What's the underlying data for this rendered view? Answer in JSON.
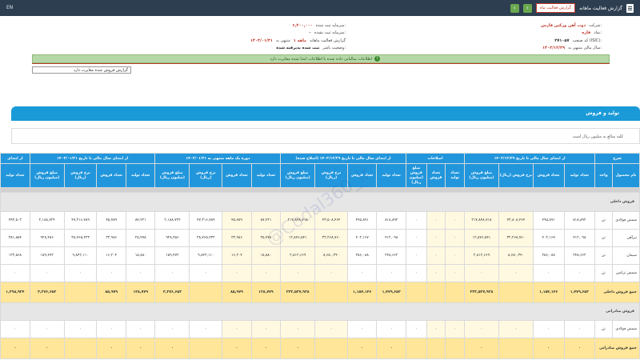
{
  "topbar": {
    "left_label": "EN",
    "title": "گزارش فعالیت ماهانه",
    "red_button": "گزارش فعالیت ماه"
  },
  "info": {
    "company_label": "شرکت:",
    "company_value": "ذوب آهن ورکین فارس",
    "symbol_label": "نماد:",
    "symbol_value": "فاره",
    "isic_label": "کد صنعت (ISIC):",
    "isic_value": "۲۷۱۰۵۷",
    "fiscal_label": "سال مالی منتهی به:",
    "fiscal_value": "۱۴۰۲/۱۲/۲۹",
    "capital_label": "سرمایه ثبت شده:",
    "capital_value": "۶,۲۰۰,۰۰۰",
    "unregistered_label": "سرمایه ثبت نشده:",
    "unregistered_value": "۰",
    "report_label": "گزارش فعالیت ماهانه",
    "month_label": "۱ ماهه",
    "period_label": "منتهی به",
    "period_value": "۱۴۰۳/۰۱/۳۱",
    "status_label": "وضعیت ناشر:",
    "status_value": "ثبت شده پذیرفته شده",
    "green_notice": "اطلاعات سالیانی داده شده با اطلاعات ابتدا شده مغایرت دارد",
    "dropdown_value": "گزارش فروش شده مغایرت دارد"
  },
  "section": {
    "title": "تولید و فروش",
    "note": "کلیه مبالغ به میلیون ریال است"
  },
  "table": {
    "groups": [
      "شرح",
      "از ابتدای سال مالی تا تاریخ ۱۴۰۲/۱۲/۲۹",
      "اصلاحات",
      "از ابتدای سال مالی تا تاریخ ۱۴۰۲/۱۲/۲۹ (اصلاح شده)",
      "دوره یک ماهه منتهی به ۱۴۰۳/۰۱/۳۱",
      "از ابتدای سال مالی تا تاریخ ۱۴۰۳/۰۱/۳۱",
      "از ابتدای"
    ],
    "columns": [
      "نام محصول",
      "واحد",
      "تعداد تولید",
      "تعداد فروش",
      "نرخ فروش (ریال)",
      "مبلغ فروش (میلیون ریال)",
      "تعداد تولید",
      "تعداد فروش",
      "مبلغ فروش (میلیون ریال)",
      "تعداد تولید",
      "تعداد فروش",
      "نرخ فروش (ریال)",
      "مبلغ فروش (میلیون ریال)",
      "تعداد تولید",
      "تعداد فروش",
      "نرخ فروش (ریال)",
      "مبلغ فروش (میلیون ریال)",
      "تعداد تولید",
      "تعداد فروش",
      "نرخ فروش (ریال)",
      "مبلغ فروش (میلیون ریال)",
      "تعداد تولید"
    ],
    "group1_label": "فروش داخلی",
    "rows": [
      {
        "name": "شمش فولادی",
        "unit": "تن",
        "c": [
          "۸۱۸,۸۹۲",
          "۴۹۵,۸۹۱",
          "۴۳,۸۰۸,۴۶۴",
          "۲۱۷,۸۴۸,۷۱۸",
          "۰",
          "۰",
          "۰",
          "۸۱۸,۸۹۲",
          "۴۹۵,۸۹۱",
          "۴۳,۵۰۸,۴۶۴",
          "۲۱۷,۸۴۸,۷۱۸",
          "۸۷,۴۲۱",
          "۴۵,۷۸۹",
          "۴۷,۳۱۶,۷۸۹",
          "۲,۱۸۸,۷۲۴",
          "۸۷,۴۲۱",
          "۴۵,۷۸۹",
          "۴۷,۳۱۶,۷۸۹",
          "۲,۱۸۸,۷۲۴",
          "۷۹۳,۵۰۲"
        ]
      },
      {
        "name": "تیرآهن",
        "unit": "تن",
        "c": [
          "۴۱۲,۰۹۸",
          "۴۰۲,۱۶۷",
          "۳۲,۲۶۸,۷۶۰",
          "۱۲,۸۷۶,۵۴۱",
          "۰",
          "۰",
          "۰",
          "۴۱۲,۰۹۸",
          "۴۰۲,۱۶۷",
          "۳۲,۲۶۸,۷۶۰",
          "۱۲,۸۷۶,۵۴۱",
          "۲۵,۴۷۸",
          "۲۳,۹۸۶",
          "۳۸,۷۶۵,۴۳۲",
          "۹۲۸,۴۵۶",
          "۲۵,۴۷۸",
          "۲۳,۹۸۶",
          "۳۸,۷۶۵,۴۳۲",
          "۹۲۸,۴۵۶",
          "۳۸۱,۸۵۴"
        ]
      },
      {
        "name": "سیمان",
        "unit": "تن",
        "c": [
          "۲۴۸,۶۶۲",
          "۲۵۶,۰۸۸",
          "۸,۶۵۰,۳۴۰",
          "۲,۸۱۲,۶۶۹",
          "۰",
          "۰",
          "۰",
          "۲۴۸,۶۶۲",
          "۲۵۶,۰۸۸",
          "۸,۶۵۰,۳۴۰",
          "۲,۸۱۲,۶۶۹",
          "۱۵,۸۸۰",
          "۱۶,۲۰۴",
          "۹,۸۴۲,۱۱۰",
          "۱۵۹,۴۷۲",
          "۱۵,۸۸۰",
          "۱۶,۲۰۴",
          "۹,۸۴۲,۱۱۰",
          "۱۵۹,۴۷۲",
          "۱۲۳,۵۶۸"
        ]
      },
      {
        "name": "شمش ترانس",
        "unit": "تن",
        "c": [
          "۰",
          "۰",
          "۰",
          "۰",
          "۰",
          "۰",
          "۰",
          "۰",
          "۰",
          "۰",
          "۰",
          "۰",
          "۰",
          "۰",
          "۰",
          "۰",
          "۰",
          "۰",
          "۰",
          "۰"
        ]
      }
    ],
    "sum1": {
      "label": "جمع فروش داخلی",
      "c": [
        "۱,۴۷۹,۶۵۲",
        "۱,۱۵۴,۱۴۶",
        "",
        "۲۳۳,۵۳۷,۹۲۸",
        "",
        "",
        "",
        "۱,۴۷۹,۶۵۲",
        "۱,۱۵۴,۱۴۶",
        "",
        "۲۳۳,۵۳۷,۹۲۸",
        "۱۲۸,۷۷۹",
        "۸۵,۹۷۹",
        "",
        "۳,۲۷۶,۶۵۲",
        "۱۲۸,۷۷۹",
        "۸۵,۹۷۹",
        "",
        "۳,۲۷۶,۶۵۲",
        "۱,۲۹۸,۹۲۴"
      ]
    },
    "group2_label": "فروش صادراتی",
    "row2": {
      "name": "شمش فولادی",
      "unit": "تن",
      "c": [
        "۰",
        "۰",
        "۰",
        "۰",
        "۰",
        "۰",
        "۰",
        "۰",
        "۰",
        "۰",
        "۰",
        "۰",
        "۰",
        "۰",
        "۰",
        "۰",
        "۰",
        "۰",
        "۰",
        "۰"
      ]
    },
    "sum2": {
      "label": "جمع فروش صادراتی",
      "c": [
        "۰",
        "۰",
        "",
        "۰",
        "",
        "",
        "",
        "۰",
        "۰",
        "",
        "۰",
        "۰",
        "۰",
        "",
        "۰",
        "۰",
        "۰",
        "",
        "۰",
        "۰"
      ]
    }
  },
  "watermark": "@Codal360_ir"
}
